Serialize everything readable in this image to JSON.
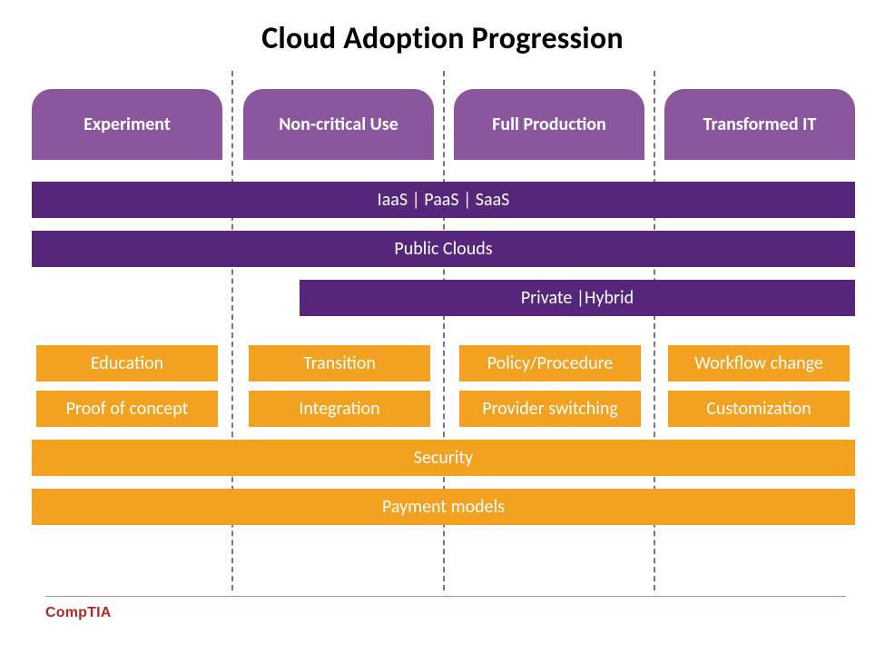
{
  "title": "Cloud Adoption Progression",
  "stages": [
    {
      "label": "Experiment"
    },
    {
      "label": "Non-critical Use"
    },
    {
      "label": "Full Production"
    },
    {
      "label": "Transformed IT"
    }
  ],
  "service_bars": {
    "iaas_paas_saas": "IaaS | PaaS | SaaS",
    "public_clouds": "Public Clouds",
    "private_hybrid": "Private |Hybrid"
  },
  "activities": {
    "row1": [
      "Education",
      "Transition",
      "Policy/Procedure",
      "Workflow change"
    ],
    "row2": [
      "Proof of concept",
      "Integration",
      "Provider switching",
      "Customization"
    ]
  },
  "spanning": {
    "security": "Security",
    "payment_models": "Payment models"
  },
  "footer": {
    "logo": "CompTIA"
  },
  "colors": {
    "stage_purple": "#8a569e",
    "bar_purple": "#55267a",
    "orange": "#f2a120",
    "logo_red": "#b02a20"
  }
}
